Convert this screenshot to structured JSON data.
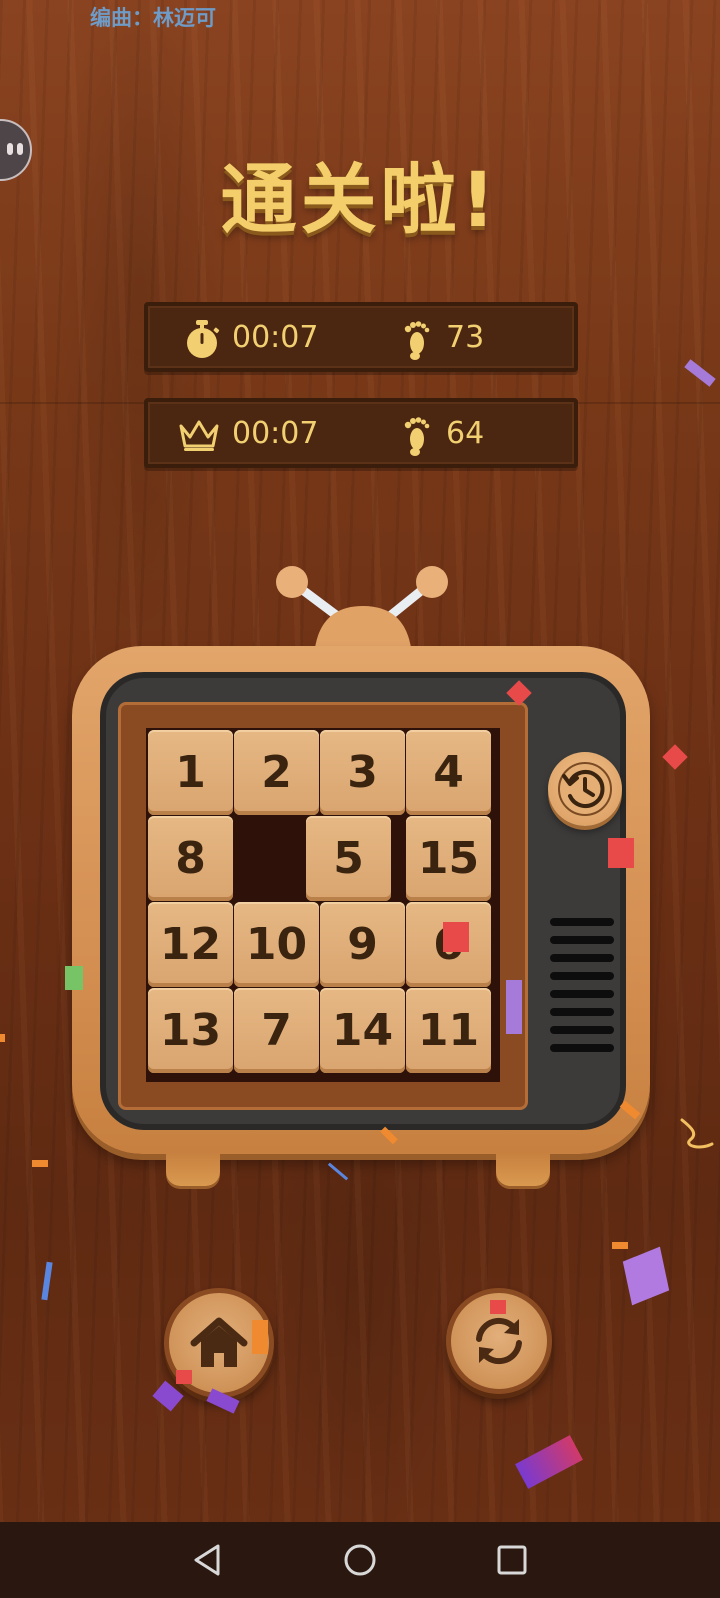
{
  "status": {
    "credit": "编曲：林迈可"
  },
  "title": "通关啦!",
  "current_result": {
    "time": "00:07",
    "steps": "73"
  },
  "best_result": {
    "time": "00:07",
    "steps": "64"
  },
  "board": {
    "rows": [
      [
        "1",
        "2",
        "3",
        "4"
      ],
      [
        "8",
        "",
        "5",
        "15"
      ],
      [
        "12",
        "10",
        "9",
        "6"
      ],
      [
        "13",
        "7",
        "14",
        "11"
      ]
    ]
  },
  "icons": {
    "timer": "stopwatch-icon",
    "steps": "footprint-icon",
    "best": "crown-icon",
    "undo": "history-icon",
    "home": "home-icon",
    "restart": "restart-icon"
  },
  "colors": {
    "accent": "#f2cf70",
    "tile": "#dcaa74",
    "background": "#6c3015"
  }
}
